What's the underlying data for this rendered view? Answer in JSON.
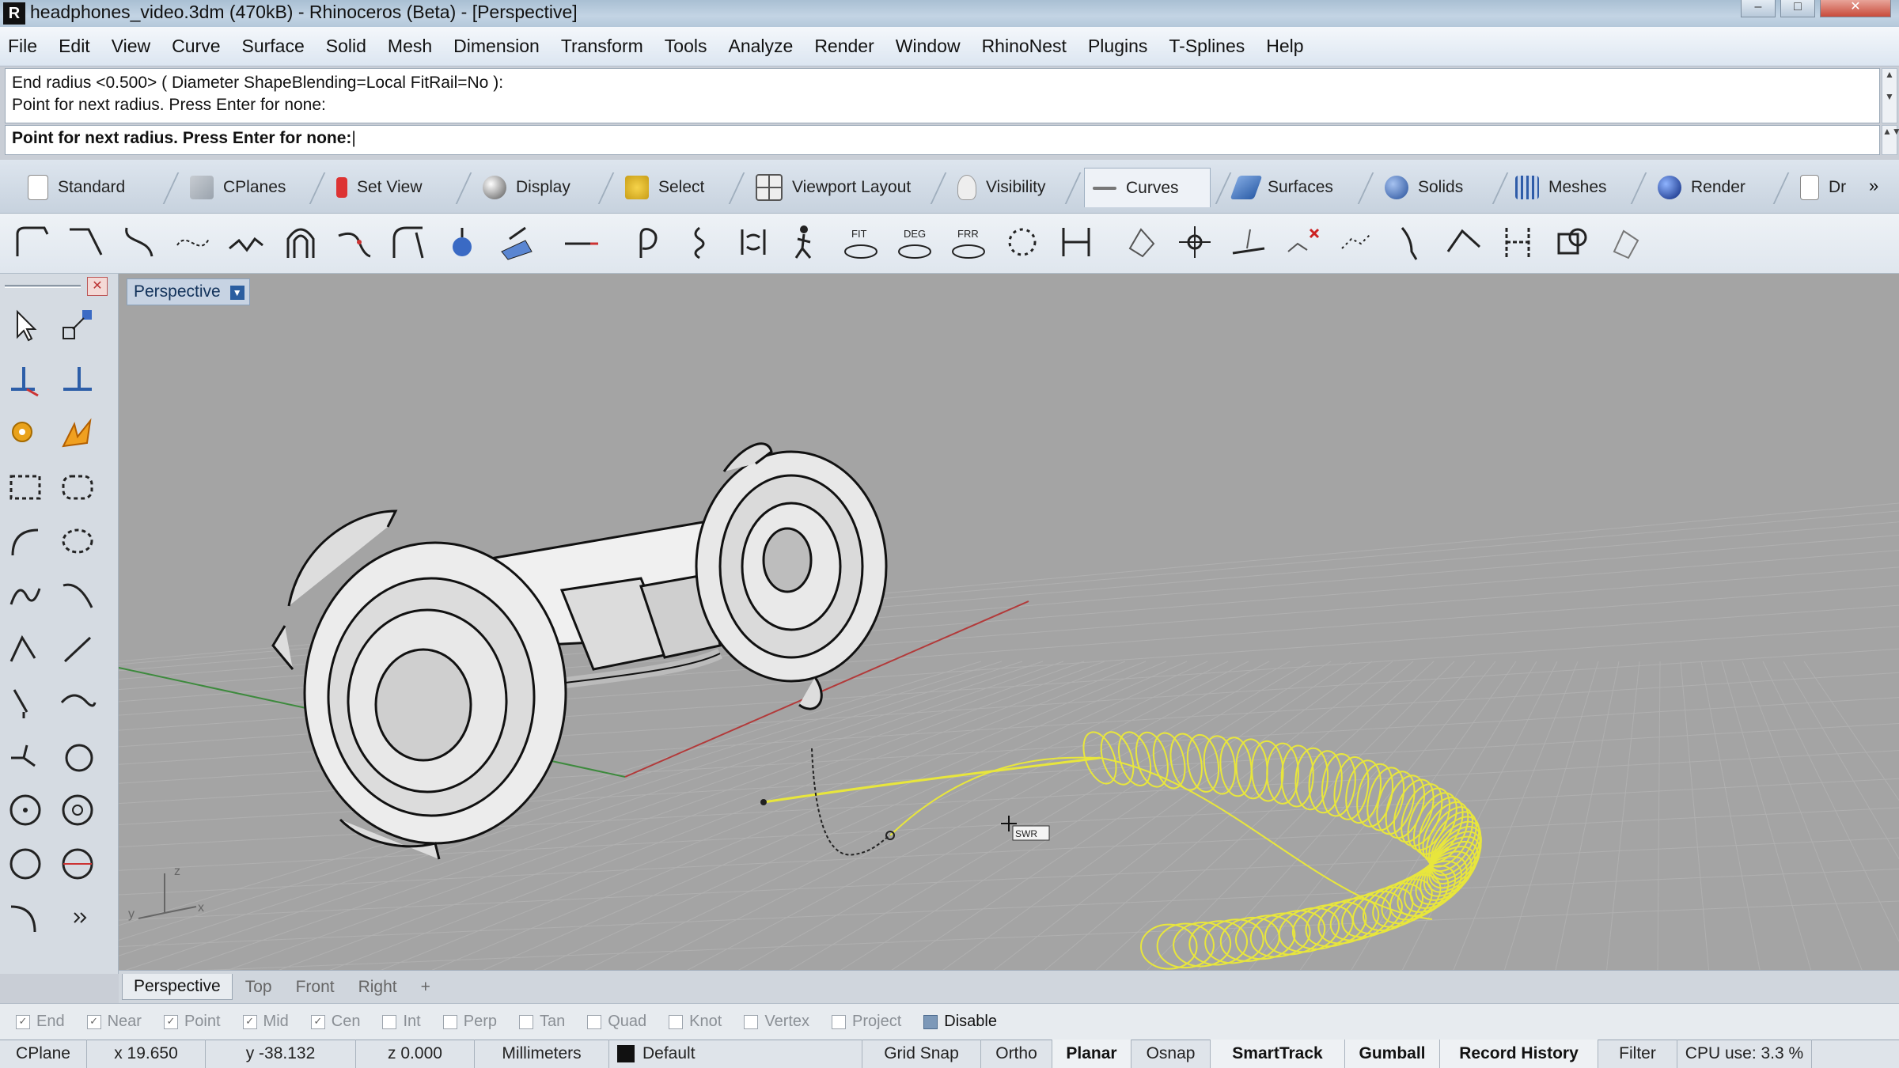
{
  "window": {
    "title": "headphones_video.3dm (470kB) - Rhinoceros (Beta) - [Perspective]",
    "app_icon": "rhino-icon"
  },
  "menu": [
    "File",
    "Edit",
    "View",
    "Curve",
    "Surface",
    "Solid",
    "Mesh",
    "Dimension",
    "Transform",
    "Tools",
    "Analyze",
    "Render",
    "Window",
    "RhinoNest",
    "Plugins",
    "T-Splines",
    "Help"
  ],
  "command": {
    "history_line1": "End radius <0.500> ( Diameter  ShapeBlending=Local  FitRail=No ):",
    "history_line2": "Point for next radius. Press Enter for none:",
    "prompt": "Point for next radius. Press Enter for none:"
  },
  "tabs": [
    {
      "label": "Standard",
      "icon": "document-icon"
    },
    {
      "label": "CPlanes",
      "icon": "cplane-icon"
    },
    {
      "label": "Set View",
      "icon": "setview-icon"
    },
    {
      "label": "Display",
      "icon": "display-sphere-icon"
    },
    {
      "label": "Select",
      "icon": "select-icon"
    },
    {
      "label": "Viewport Layout",
      "icon": "viewport-layout-icon"
    },
    {
      "label": "Visibility",
      "icon": "lightbulb-icon"
    },
    {
      "label": "Curves",
      "icon": "curves-icon",
      "active": true
    },
    {
      "label": "Surfaces",
      "icon": "surfaces-icon"
    },
    {
      "label": "Solids",
      "icon": "solids-icon"
    },
    {
      "label": "Meshes",
      "icon": "meshes-icon"
    },
    {
      "label": "Render",
      "icon": "render-sphere-icon"
    },
    {
      "label": "Dr",
      "icon": "drafting-icon"
    }
  ],
  "tabs_overflow": "»",
  "toolbar_text": {
    "fit": "FIT",
    "deg": "DEG",
    "frr": "FRR"
  },
  "viewport": {
    "active_label": "Perspective",
    "axis_labels": {
      "x": "x",
      "y": "y",
      "z": "z"
    },
    "colors": {
      "background": "#a4a4a4",
      "grid": "#b0b0b0",
      "x_axis": "#b23a3a",
      "y_axis": "#3d8a3d",
      "selected_curve": "#e8e63c",
      "wire": "#1a1a1a",
      "model": "#e6e6e6"
    }
  },
  "viewport_tabs": [
    "Perspective",
    "Top",
    "Front",
    "Right",
    "+"
  ],
  "osnaps": [
    {
      "label": "End",
      "checked": true
    },
    {
      "label": "Near",
      "checked": true
    },
    {
      "label": "Point",
      "checked": true
    },
    {
      "label": "Mid",
      "checked": true
    },
    {
      "label": "Cen",
      "checked": true
    },
    {
      "label": "Int",
      "checked": false
    },
    {
      "label": "Perp",
      "checked": false
    },
    {
      "label": "Tan",
      "checked": false
    },
    {
      "label": "Quad",
      "checked": false
    },
    {
      "label": "Knot",
      "checked": false
    },
    {
      "label": "Vertex",
      "checked": false
    },
    {
      "label": "Project",
      "checked": false
    },
    {
      "label": "Disable",
      "checked": true
    }
  ],
  "status": {
    "cplane": "CPlane",
    "x": "x 19.650",
    "y": "y -38.132",
    "z": "z 0.000",
    "units": "Millimeters",
    "layer": "Default",
    "grid_snap": "Grid Snap",
    "ortho": "Ortho",
    "planar": "Planar",
    "osnap": "Osnap",
    "smarttrack": "SmartTrack",
    "gumball": "Gumball",
    "record_history": "Record History",
    "filter": "Filter",
    "cpu": "CPU use: 3.3 %"
  },
  "cursor_label": "SWR"
}
